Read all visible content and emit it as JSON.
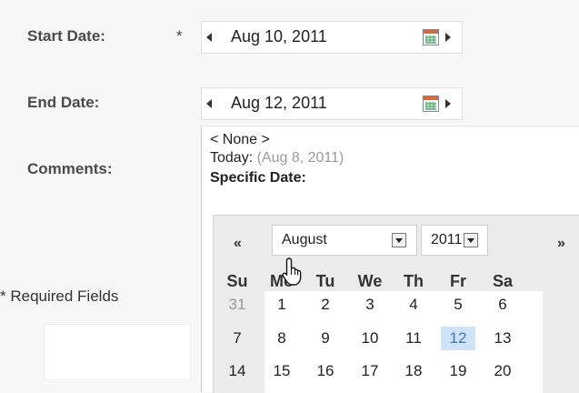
{
  "form": {
    "start_date_label": "Start Date:",
    "required_star": "*",
    "start_date_value": "Aug 10, 2011",
    "end_date_label": "End Date:",
    "end_date_value": "Aug 12, 2011",
    "comments_label": "Comments:",
    "required_fields_note": "* Required Fields"
  },
  "dropdown": {
    "none_option": "< None >",
    "today_label": "Today:",
    "today_value": "(Aug 8, 2011)",
    "specific_date_label": "Specific Date:"
  },
  "calendar": {
    "prev_label": "«",
    "next_label": "»",
    "month_selected": "August",
    "year_selected": "2011",
    "weekdays": [
      "Su",
      "Mo",
      "Tu",
      "We",
      "Th",
      "Fr",
      "Sa"
    ],
    "weeks": [
      [
        "31",
        "1",
        "2",
        "3",
        "4",
        "5",
        "6"
      ],
      [
        "7",
        "8",
        "9",
        "10",
        "11",
        "12",
        "13"
      ],
      [
        "14",
        "15",
        "16",
        "17",
        "18",
        "19",
        "20"
      ]
    ],
    "selected_day": "12",
    "outside_month_day": "31"
  },
  "colors": {
    "selected_day_bg": "#cfe2f8",
    "selected_day_text": "#3a78c2"
  }
}
